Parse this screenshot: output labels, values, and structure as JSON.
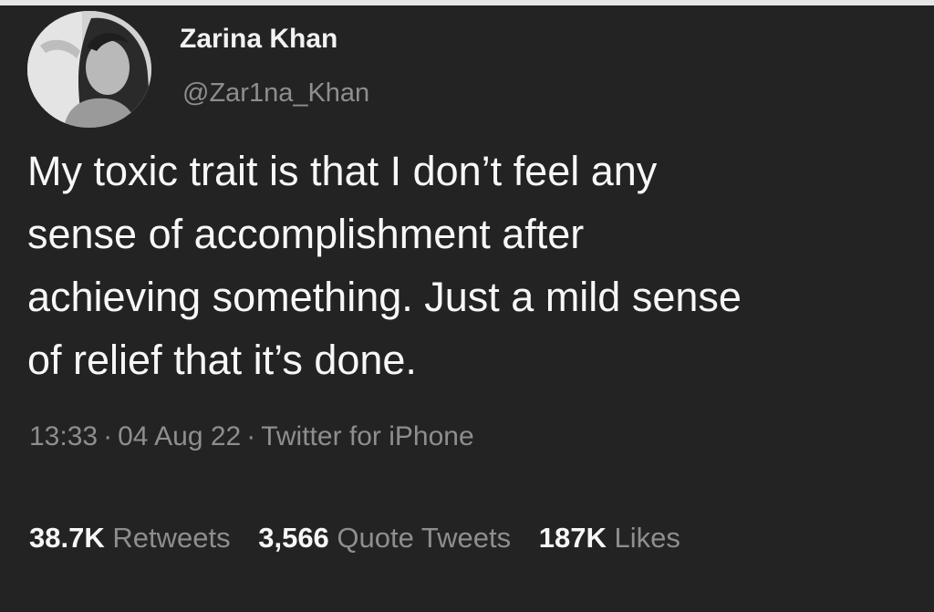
{
  "user": {
    "display_name": "Zarina Khan",
    "handle": "@Zar1na_Khan",
    "avatar_icon": "profile-photo"
  },
  "tweet": {
    "lines": [
      "My toxic trait is that I don’t feel any",
      "sense of accomplishment after",
      "achieving something. Just a mild sense",
      "of relief that it’s done."
    ]
  },
  "meta": {
    "time": "13:33",
    "separator": "·",
    "date": "04 Aug 22",
    "source": "Twitter for iPhone"
  },
  "stats": {
    "retweets_count": "38.7K",
    "retweets_label": "Retweets",
    "quotes_count": "3,566",
    "quotes_label": "Quote Tweets",
    "likes_count": "187K",
    "likes_label": "Likes"
  }
}
